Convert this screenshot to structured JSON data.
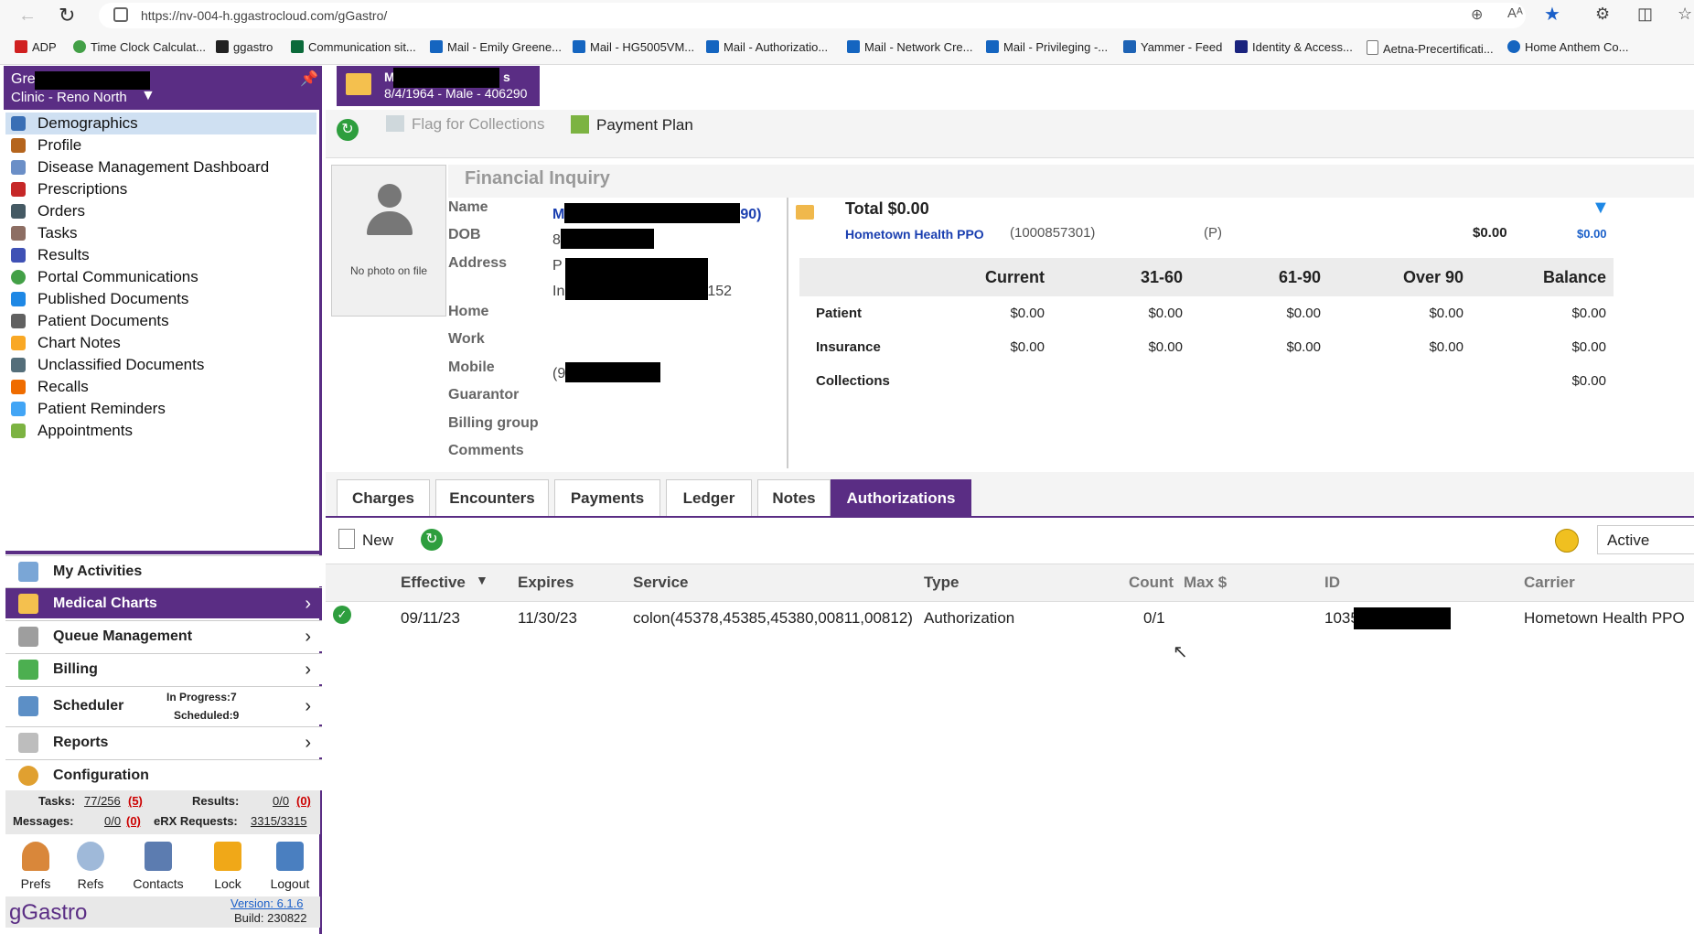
{
  "browser": {
    "url": "https://nv-004-h.ggastrocloud.com/gGastro/",
    "bookmarks": [
      {
        "label": "ADP",
        "color": "#d02020"
      },
      {
        "label": "Time Clock Calculat...",
        "color": "#43a047"
      },
      {
        "label": "ggastro",
        "color": "#222222"
      },
      {
        "label": "Communication sit...",
        "color": "#0b6a3a"
      },
      {
        "label": "Mail - Emily Greene...",
        "color": "#1565c0"
      },
      {
        "label": "Mail - HG5005VM...",
        "color": "#1565c0"
      },
      {
        "label": "Mail - Authorizatio...",
        "color": "#1565c0"
      },
      {
        "label": "Mail - Network Cre...",
        "color": "#1565c0"
      },
      {
        "label": "Mail - Privileging -...",
        "color": "#1565c0"
      },
      {
        "label": "Yammer - Feed",
        "color": "#1e63b5"
      },
      {
        "label": "Identity & Access...",
        "color": "#1a237e"
      },
      {
        "label": "Aetna-Precertificati...",
        "color": "#9e9e9e"
      },
      {
        "label": "Home Anthem Co...",
        "color": "#1565c0"
      }
    ]
  },
  "sidebar": {
    "header_line1": "Gre",
    "header_line2": "Clinic - Reno North",
    "items": [
      {
        "label": "Demographics",
        "color": "#3a6fb5"
      },
      {
        "label": "Profile",
        "color": "#b5651d"
      },
      {
        "label": "Disease Management Dashboard",
        "color": "#6b8fc7"
      },
      {
        "label": "Prescriptions",
        "color": "#c62828"
      },
      {
        "label": "Orders",
        "color": "#455a64"
      },
      {
        "label": "Tasks",
        "color": "#8d6e63"
      },
      {
        "label": "Results",
        "color": "#3f51b5"
      },
      {
        "label": "Portal Communications",
        "color": "#43a047"
      },
      {
        "label": "Published Documents",
        "color": "#1e88e5"
      },
      {
        "label": "Patient Documents",
        "color": "#616161"
      },
      {
        "label": "Chart Notes",
        "color": "#f9a825"
      },
      {
        "label": "Unclassified Documents",
        "color": "#546e7a"
      },
      {
        "label": "Recalls",
        "color": "#ef6c00"
      },
      {
        "label": "Patient Reminders",
        "color": "#42a5f5"
      },
      {
        "label": "Appointments",
        "color": "#7cb342"
      }
    ],
    "sections": {
      "my_activities": "My Activities",
      "medical_charts": "Medical Charts",
      "queue_management": "Queue Management",
      "billing": "Billing",
      "scheduler": "Scheduler",
      "scheduler_in_progress": "In Progress:7",
      "scheduler_scheduled": "Scheduled:9",
      "reports": "Reports",
      "configuration": "Configuration"
    },
    "status": {
      "tasks_label": "Tasks:",
      "tasks_value": "77/256",
      "tasks_extra": "(5)",
      "results_label": "Results:",
      "results_value": "0/0",
      "results_extra": "(0)",
      "messages_label": "Messages:",
      "messages_value": "0/0",
      "messages_extra": "(0)",
      "erx_label": "eRX Requests:",
      "erx_value": "3315/3315"
    },
    "tools": [
      "Prefs",
      "Refs",
      "Contacts",
      "Lock",
      "Logout"
    ],
    "brand": "gGastro",
    "version": "Version: 6.1.6",
    "build": "Build: 230822"
  },
  "patient_tab": {
    "line1_start": "M",
    "line1_end": "s",
    "line2": "8/4/1964 - Male - 406290"
  },
  "toolbar": {
    "flag_label": "Flag for Collections",
    "payment_plan_label": "Payment Plan"
  },
  "demographics": {
    "title": "Financial Inquiry",
    "no_photo": "No photo on file",
    "labels": [
      "Name",
      "DOB",
      "Address",
      "Home",
      "Work",
      "Mobile",
      "Guarantor",
      "Billing group",
      "Comments"
    ],
    "name_start": "M",
    "name_end": "90)",
    "dob_start": "8",
    "address_start": "P",
    "address2_start": "In",
    "address2_end": "152",
    "mobile_start": "(9"
  },
  "financial": {
    "total": "Total $0.00",
    "carrier": "Hometown Health PPO",
    "policy": "(1000857301)",
    "priority": "(P)",
    "carrier_amount": "$0.00",
    "carrier_amount_link": "$0.00",
    "columns": [
      "Current",
      "31-60",
      "61-90",
      "Over 90",
      "Balance"
    ],
    "rows": [
      {
        "label": "Patient",
        "values": [
          "$0.00",
          "$0.00",
          "$0.00",
          "$0.00",
          "$0.00"
        ]
      },
      {
        "label": "Insurance",
        "values": [
          "$0.00",
          "$0.00",
          "$0.00",
          "$0.00",
          "$0.00"
        ]
      },
      {
        "label": "Collections",
        "values": [
          "",
          "",
          "",
          "",
          "$0.00"
        ]
      }
    ]
  },
  "tabs": [
    "Charges",
    "Encounters",
    "Payments",
    "Ledger",
    "Notes",
    "Authorizations"
  ],
  "auth_toolbar": {
    "new_label": "New",
    "filter_value": "Active"
  },
  "auth_table": {
    "headers": [
      "Effective",
      "Expires",
      "Service",
      "Type",
      "Count",
      "Max $",
      "ID",
      "Carrier"
    ],
    "row": {
      "effective": "09/11/23",
      "expires": "11/30/23",
      "service": "colon(45378,45385,45380,00811,00812)",
      "type": "Authorization",
      "count": "0/1",
      "max": "",
      "id_start": "1035",
      "carrier": "Hometown Health PPO"
    }
  }
}
